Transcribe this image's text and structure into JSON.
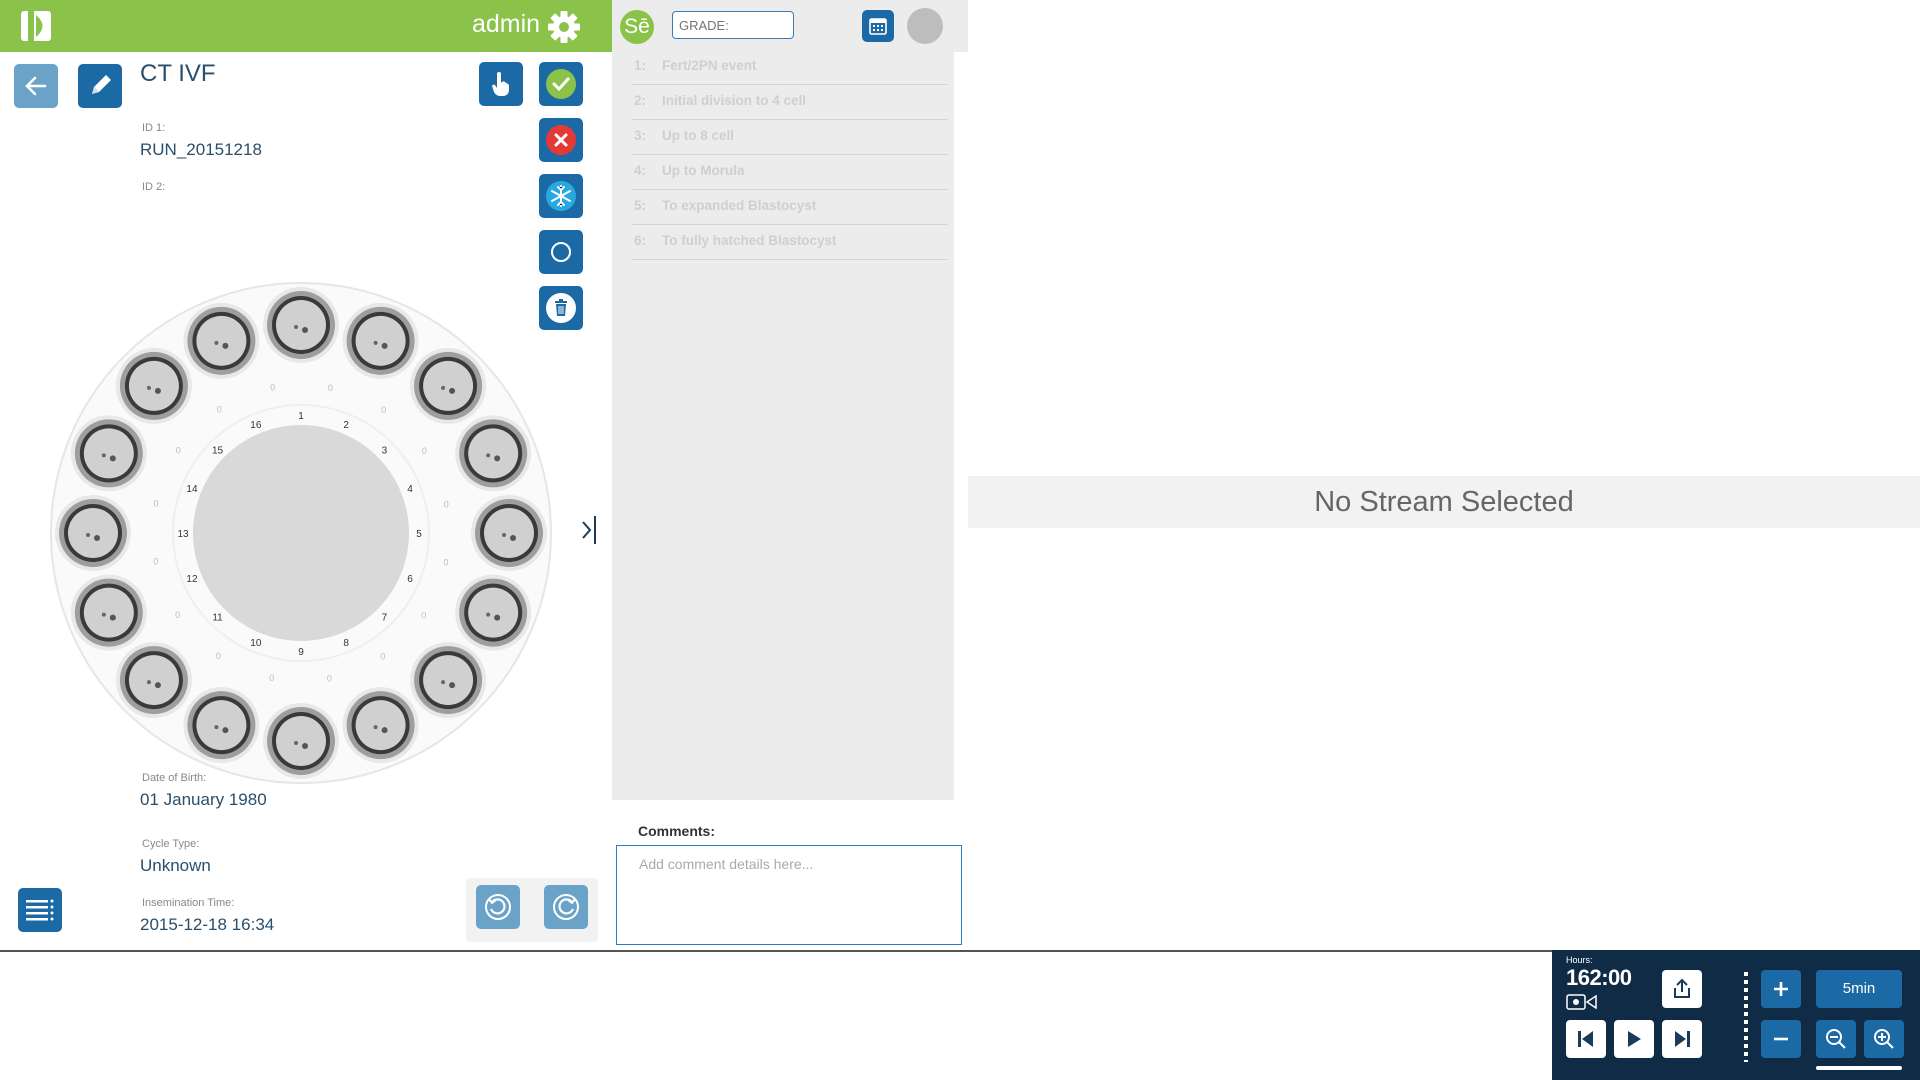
{
  "header": {
    "user": "admin"
  },
  "patient": {
    "title": "CT IVF",
    "id1_label": "ID 1:",
    "id1_value": "RUN_20151218",
    "id2_label": "ID 2:",
    "id2_value": "",
    "dob_label": "Date of Birth:",
    "dob_value": "01 January 1980",
    "cycle_label": "Cycle Type:",
    "cycle_value": "Unknown",
    "insem_label": "Insemination Time:",
    "insem_value": "2015-12-18 16:34"
  },
  "dish": {
    "wells": [
      "1",
      "2",
      "3",
      "4",
      "5",
      "6",
      "7",
      "8",
      "9",
      "10",
      "11",
      "12",
      "13",
      "14",
      "15",
      "16"
    ],
    "counts": [
      "0",
      "0",
      "0",
      "0",
      "0",
      "0",
      "0",
      "0",
      "0",
      "0",
      "0",
      "0",
      "0",
      "0",
      "0",
      "0"
    ]
  },
  "grading": {
    "grade_placeholder": "GRADE:",
    "badge": "Sē",
    "stages": [
      {
        "num": "1:",
        "label": "Fert/2PN event"
      },
      {
        "num": "2:",
        "label": "Initial division to 4 cell"
      },
      {
        "num": "3:",
        "label": "Up to 8 cell"
      },
      {
        "num": "4:",
        "label": "Up to Morula"
      },
      {
        "num": "5:",
        "label": "To expanded Blastocyst"
      },
      {
        "num": "6:",
        "label": "To fully hatched Blastocyst"
      }
    ],
    "comments_label": "Comments:",
    "comments_placeholder": "Add comment details here..."
  },
  "viewer": {
    "no_stream": "No Stream Selected"
  },
  "player": {
    "hours_label": "Hours:",
    "hours_value": "162:00",
    "interval_label": "5min"
  },
  "colors": {
    "header_green": "#8bc34a",
    "button_blue": "#1b6aa5",
    "player_bg": "#0f2b46",
    "accept_green": "#8bc34a",
    "reject_red": "#e53935"
  }
}
